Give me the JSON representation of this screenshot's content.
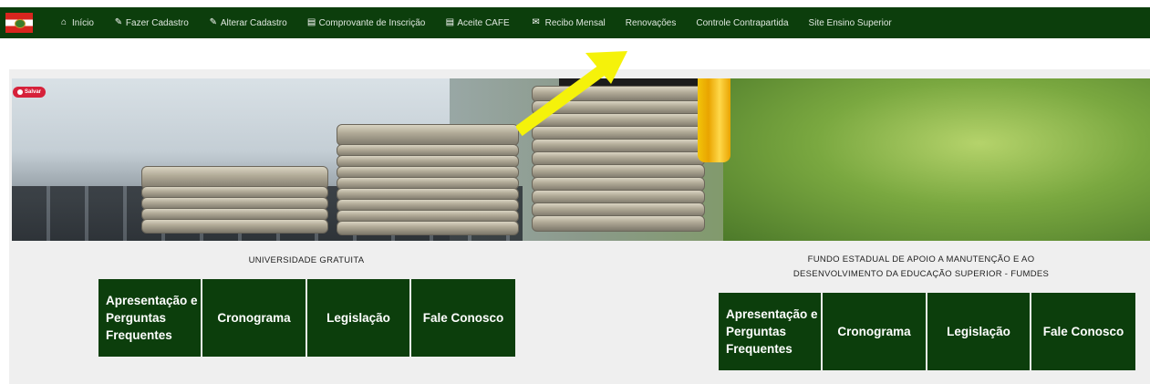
{
  "nav": {
    "items": [
      {
        "label": "Início",
        "icon": "home-icon"
      },
      {
        "label": "Fazer Cadastro",
        "icon": "edit-icon"
      },
      {
        "label": "Alterar Cadastro",
        "icon": "edit-icon"
      },
      {
        "label": "Comprovante de Inscrição",
        "icon": "document-icon"
      },
      {
        "label": "Aceite CAFE",
        "icon": "document-icon"
      },
      {
        "label": "Recibo Mensal",
        "icon": "envelope-icon"
      },
      {
        "label": "Renovações",
        "icon": ""
      },
      {
        "label": "Controle Contrapartida",
        "icon": ""
      },
      {
        "label": "Site Ensino Superior",
        "icon": ""
      }
    ]
  },
  "banner": {
    "save_label": "Salvar"
  },
  "left_section": {
    "title": "UNIVERSIDADE GRATUITA",
    "buttons": [
      "Apresentação e Perguntas Frequentes",
      "Cronograma",
      "Legislação",
      "Fale Conosco"
    ]
  },
  "right_section": {
    "title_line1": "FUNDO ESTADUAL DE APOIO A MANUTENÇÃO E AO",
    "title_line2": "DESENVOLVIMENTO DA EDUCAÇÃO SUPERIOR - FUMDES",
    "buttons": [
      "Apresentação e Perguntas Frequentes",
      "Cronograma",
      "Legislação",
      "Fale Conosco"
    ]
  },
  "colors": {
    "nav_bg": "#0c3e0c",
    "tile_bg": "#0c3e0c",
    "annotation_arrow": "#f5f20a"
  }
}
